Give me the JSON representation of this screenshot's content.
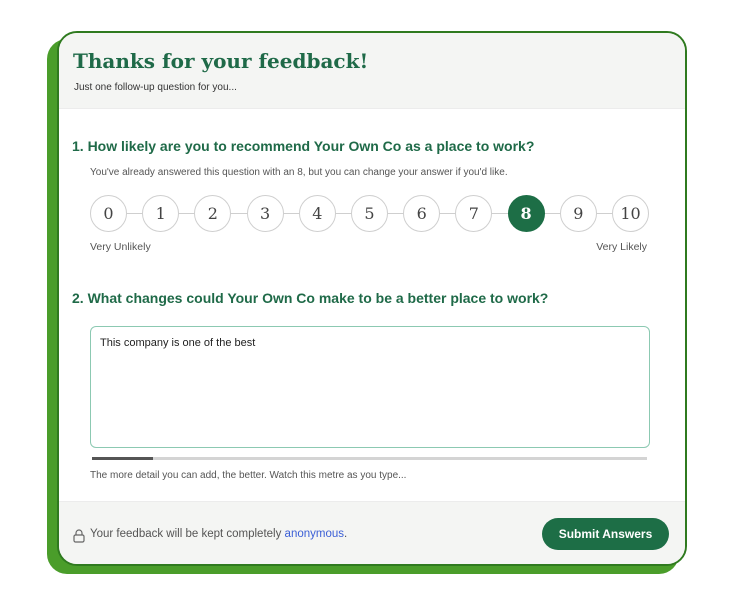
{
  "header": {
    "title": "Thanks for your feedback!",
    "subtitle": "Just one follow-up question for you..."
  },
  "question1": {
    "title": "1.  How likely are you to recommend Your Own Co as a place to work?",
    "note": "You've already answered this question with an 8, but you can change your answer if you'd like.",
    "scale": [
      "0",
      "1",
      "2",
      "3",
      "4",
      "5",
      "6",
      "7",
      "8",
      "9",
      "10"
    ],
    "selected_value": "8",
    "low_label": "Very Unlikely",
    "high_label": "Very Likely"
  },
  "question2": {
    "title": "2.  What changes could Your Own Co make to be a better place to work?",
    "answer_value": "This company is one of the best",
    "meter_fraction": 0.11,
    "meter_hint": "The more detail you can add, the better. Watch this metre as you type..."
  },
  "footer": {
    "privacy_text": "Your feedback will be kept completely ",
    "privacy_link": "anonymous",
    "privacy_end": ".",
    "submit_label": "Submit Answers"
  },
  "colors": {
    "brand": "#1d6e46",
    "frame": "#4a9d2a",
    "link": "#3b5fd6"
  }
}
